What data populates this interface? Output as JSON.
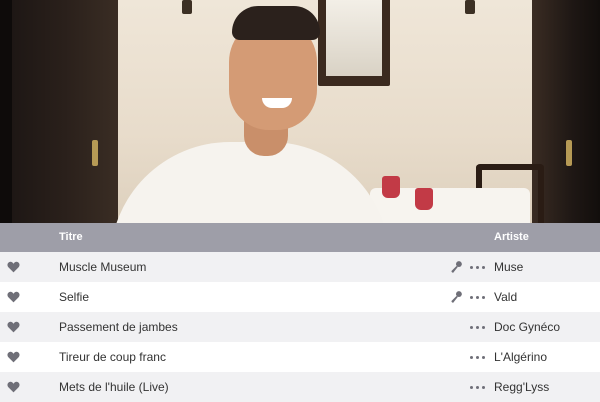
{
  "header": {
    "title_label": "Titre",
    "artist_label": "Artiste"
  },
  "tracks": [
    {
      "title": "Muscle Museum",
      "artist": "Muse",
      "lyrics": true
    },
    {
      "title": "Selfie",
      "artist": "Vald",
      "lyrics": true
    },
    {
      "title": "Passement de jambes",
      "artist": "Doc Gynéco",
      "lyrics": false
    },
    {
      "title": "Tireur de coup franc",
      "artist": "L'Algérino",
      "lyrics": false
    },
    {
      "title": "Mets de l'huile (Live)",
      "artist": "Regg'Lyss",
      "lyrics": false
    }
  ],
  "icons": {
    "favorite": "heart-icon",
    "lyrics": "microphone-icon",
    "more": "more-options-icon"
  },
  "colors": {
    "header_bg": "#9e9ea8",
    "row_alt_bg": "#f1f1f3",
    "icon_gray": "#6f6f78"
  }
}
